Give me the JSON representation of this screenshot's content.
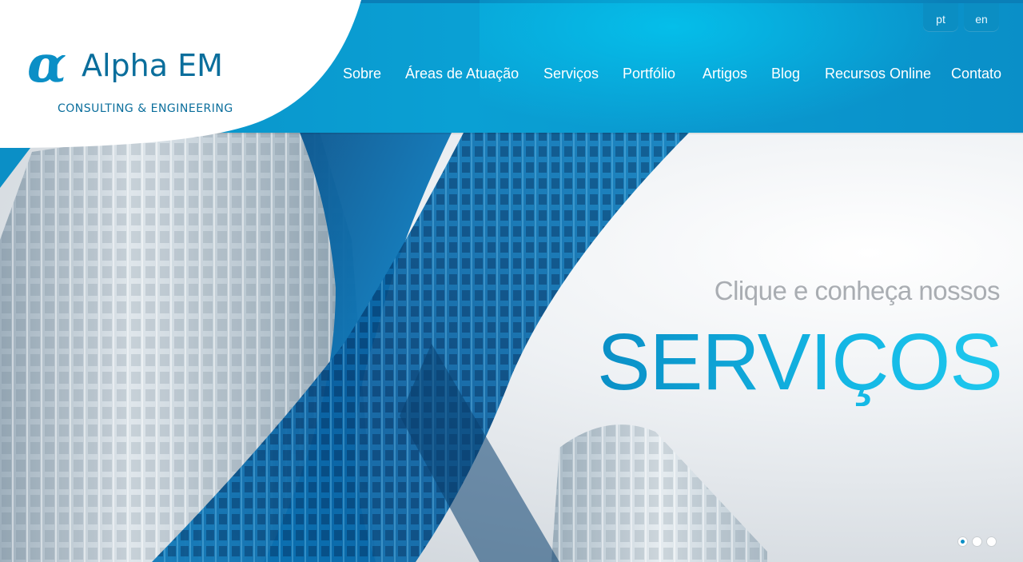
{
  "brand": {
    "logo_symbol": "α",
    "name": "Alpha EM",
    "tagline": "CONSULTING & ENGINEERING",
    "primary_color": "#0b8fc6",
    "dark_color": "#0a6e9c"
  },
  "languages": [
    {
      "code": "pt"
    },
    {
      "code": "en"
    }
  ],
  "nav": [
    {
      "label": "Sobre"
    },
    {
      "label": "Áreas de Atuação"
    },
    {
      "label": "Serviços"
    },
    {
      "label": "Portfólio"
    },
    {
      "label": "Artigos"
    },
    {
      "label": "Blog"
    },
    {
      "label": "Recursos Online"
    },
    {
      "label": "Contato"
    }
  ],
  "hero": {
    "subtitle": "Clique e conheça nossos",
    "title": "SERVIÇOS",
    "title_color": "#13b6e4",
    "subtitle_color": "#a9adb2"
  },
  "slider": {
    "slide_count": 3,
    "active_index": 0
  }
}
